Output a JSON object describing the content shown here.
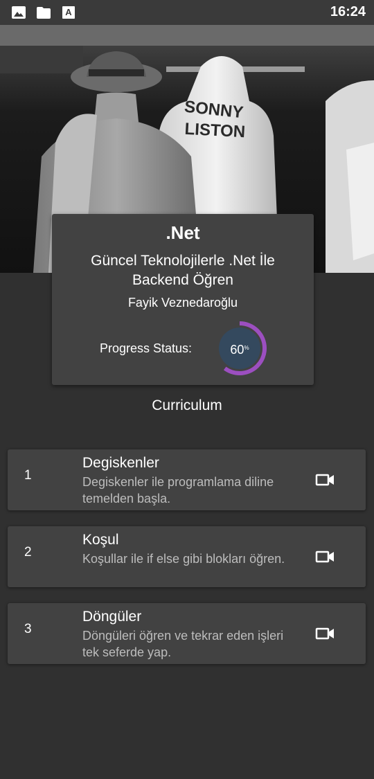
{
  "status_bar": {
    "time": "16:24",
    "icons": [
      "image-icon",
      "folder-icon",
      "font-icon"
    ]
  },
  "course": {
    "title": ".Net",
    "subtitle": "Güncel Teknolojilerle .Net İle Backend Öğren",
    "author": "Fayik Veznedaroğlu",
    "progress_label": "Progress Status:",
    "progress_value": "60",
    "progress_unit": "%",
    "progress_fraction": 0.6
  },
  "curriculum": {
    "heading": "Curriculum",
    "lessons": [
      {
        "number": "1",
        "title": "Degiskenler",
        "description": "Degiskenler ile programlama diline temelden başla.",
        "icon": "video-camera-icon"
      },
      {
        "number": "2",
        "title": "Koşul",
        "description": "Koşullar ile if else gibi blokları öğren.",
        "icon": "video-camera-icon"
      },
      {
        "number": "3",
        "title": "Döngüler",
        "description": "Döngüleri öğren ve tekrar eden işleri tek seferde yap.",
        "icon": "video-camera-icon"
      }
    ]
  },
  "colors": {
    "background": "#303030",
    "card": "#424242",
    "progress_accent": "#9c4fc0",
    "progress_fill": "#34495e"
  }
}
